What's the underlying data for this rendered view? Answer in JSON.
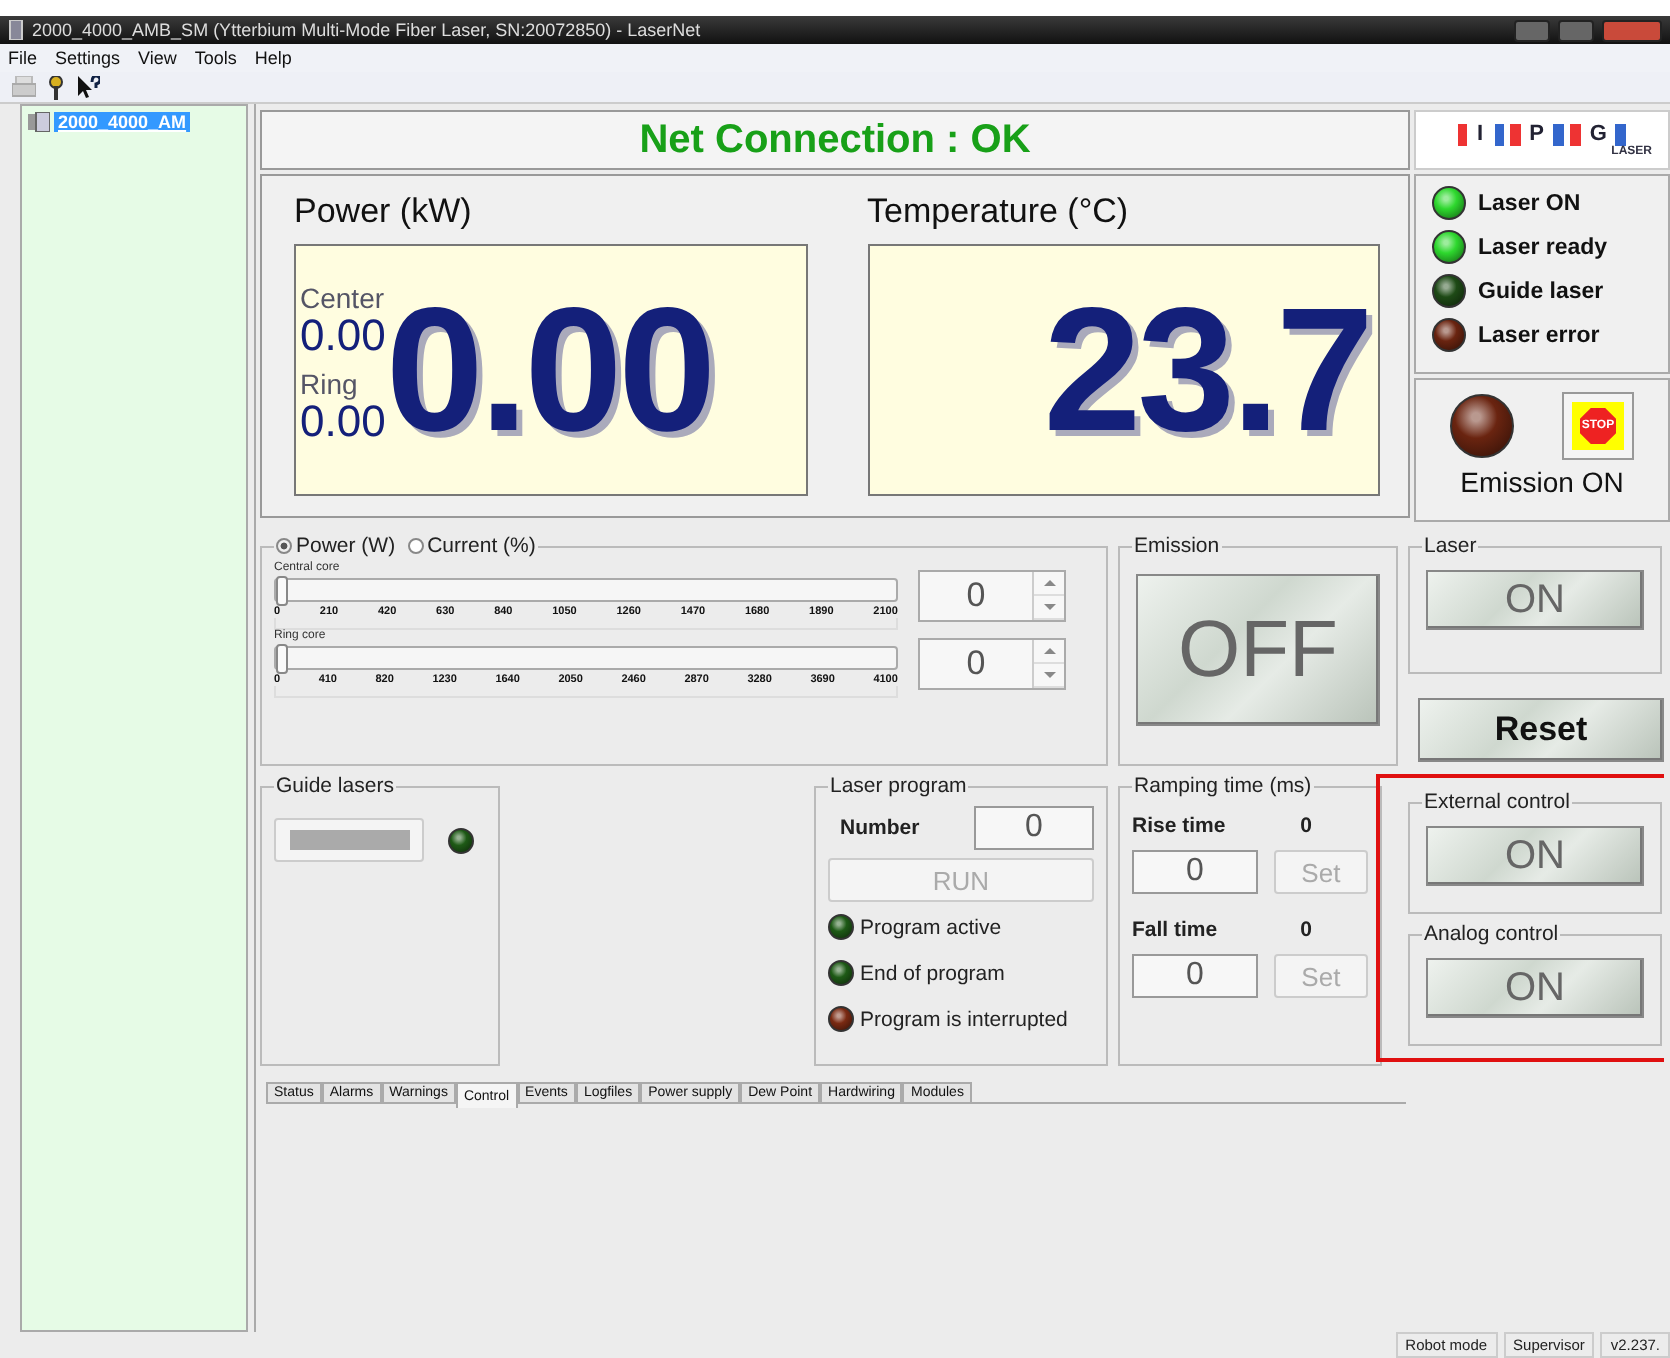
{
  "window": {
    "title": "2000_4000_AMB_SM (Ytterbium Multi-Mode Fiber Laser, SN:20072850) - LaserNet"
  },
  "menu": [
    "File",
    "Settings",
    "View",
    "Tools",
    "Help"
  ],
  "tree": [
    {
      "label": "2000_4000_AM",
      "selected": true
    }
  ],
  "net_connection": "Net Connection : OK",
  "logo": {
    "letters": [
      "I",
      "P",
      "G"
    ],
    "sub": "LASER"
  },
  "power": {
    "title": "Power (kW)",
    "center_label": "Center",
    "center_value": "0.00",
    "ring_label": "Ring",
    "ring_value": "0.00",
    "total": "0.00"
  },
  "temperature": {
    "title": "Temperature (°C)",
    "value": "23.7"
  },
  "indicators": [
    {
      "label": "Laser ON",
      "color": "#2ed82e"
    },
    {
      "label": "Laser ready",
      "color": "#2ed82e"
    },
    {
      "label": "Guide laser",
      "color": "#1e4a16"
    },
    {
      "label": "Laser error",
      "color": "#6a2410"
    }
  ],
  "emission_status": {
    "label": "Emission ON",
    "color": "#6a2410",
    "stop": "STOP"
  },
  "mode": [
    {
      "label": "Power (W)",
      "selected": true
    },
    {
      "label": "Current (%)",
      "selected": false
    }
  ],
  "sliders": [
    {
      "label": "Central core",
      "level": 0,
      "value": "0",
      "ticks": [
        "0",
        "210",
        "420",
        "630",
        "840",
        "1050",
        "1260",
        "1470",
        "1680",
        "1890",
        "2100"
      ]
    },
    {
      "label": "Ring core",
      "level": 0,
      "value": "0",
      "ticks": [
        "0",
        "410",
        "820",
        "1230",
        "1640",
        "2050",
        "2460",
        "2870",
        "3280",
        "3690",
        "4100"
      ]
    }
  ],
  "emission": {
    "title": "Emission",
    "button": "OFF"
  },
  "laser": {
    "title": "Laser",
    "button": "ON"
  },
  "reset": "Reset",
  "guide_lasers": {
    "title": "Guide lasers",
    "color": "#1e5a16"
  },
  "laser_program": {
    "title": "Laser program",
    "number_label": "Number",
    "number": "0",
    "run": "RUN",
    "run_disabled": true,
    "indicators": [
      {
        "label": "Program active",
        "color": "#1e5a16"
      },
      {
        "label": "End of program",
        "color": "#1e5a16"
      },
      {
        "label": "Program is interrupted",
        "color": "#7a2a12"
      }
    ]
  },
  "ramping": {
    "title": "Ramping time (ms)",
    "rows": [
      {
        "label": "Rise time",
        "reading": "0",
        "value": "0",
        "button": "Set"
      },
      {
        "label": "Fall time",
        "reading": "0",
        "value": "0",
        "button": "Set"
      }
    ]
  },
  "controls": {
    "highlighted": true,
    "items": [
      {
        "title": "External control",
        "button": "ON"
      },
      {
        "title": "Analog control",
        "button": "ON"
      }
    ]
  },
  "tabs": [
    {
      "label": "Status",
      "selected": false
    },
    {
      "label": "Alarms",
      "selected": false
    },
    {
      "label": "Warnings",
      "selected": false
    },
    {
      "label": "Control",
      "selected": true
    },
    {
      "label": "Events",
      "selected": false
    },
    {
      "label": "Logfiles",
      "selected": false
    },
    {
      "label": "Power supply",
      "selected": false
    },
    {
      "label": "Dew Point",
      "selected": false
    },
    {
      "label": "Hardwiring",
      "selected": false
    },
    {
      "label": "Modules",
      "selected": false
    }
  ],
  "status_bar": [
    "Robot mode",
    "Supervisor",
    "v2.237."
  ]
}
